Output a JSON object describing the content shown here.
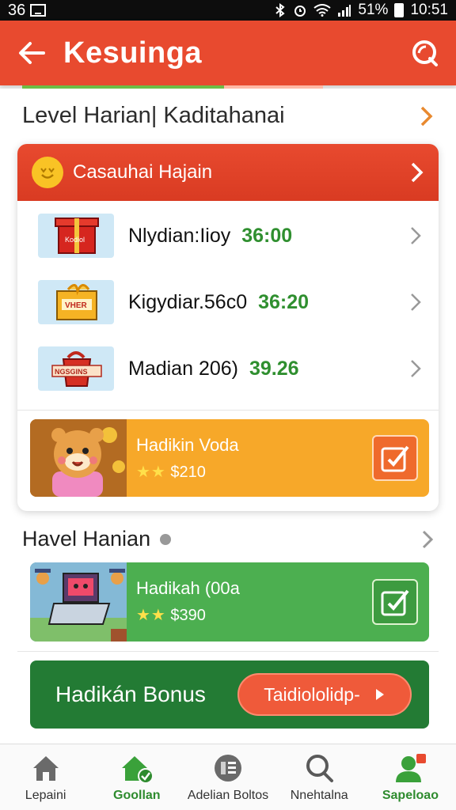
{
  "status_bar": {
    "left_text": "36",
    "battery": "51%",
    "time": "10:51"
  },
  "header": {
    "title": "Kesuinga"
  },
  "progress": {
    "fraction": 0.67
  },
  "section1": {
    "title": "Level Harian| Kaditahanai"
  },
  "card": {
    "header_label": "Casauhai Hajain",
    "rows": [
      {
        "name": "Nlydian:Iioy",
        "amount": "36:00",
        "thumb_label": "Kodiol"
      },
      {
        "name": "Kigydiar.56c0",
        "amount": "36:20",
        "thumb_label": "VHER"
      },
      {
        "name": "Madian 206)",
        "amount": "39.26",
        "thumb_label": "NGSGINS"
      }
    ],
    "promo": {
      "title": "Hadikin Voda",
      "stars": "★★",
      "price": "$210"
    }
  },
  "section2": {
    "title": "Havel Hanian",
    "promo": {
      "title": "Hadikah (00a",
      "stars": "★★",
      "price": "$390"
    }
  },
  "bonus": {
    "label": "Hadikán Bonus",
    "button_label": "Taidiololidp-"
  },
  "bottom_nav": [
    {
      "label": "Lepaini",
      "icon": "home-icon"
    },
    {
      "label": "Goollan",
      "icon": "home-check-icon"
    },
    {
      "label": "Adelian Boltos",
      "icon": "list-icon"
    },
    {
      "label": "Nnehtalna",
      "icon": "search-icon"
    },
    {
      "label": "Sapeloao",
      "icon": "profile-icon"
    }
  ],
  "colors": {
    "primary": "#e84a2f",
    "green": "#2f8f2f",
    "orange_banner": "#f5a623",
    "green_banner": "#4caf50",
    "bonus_bg": "#237b34"
  }
}
